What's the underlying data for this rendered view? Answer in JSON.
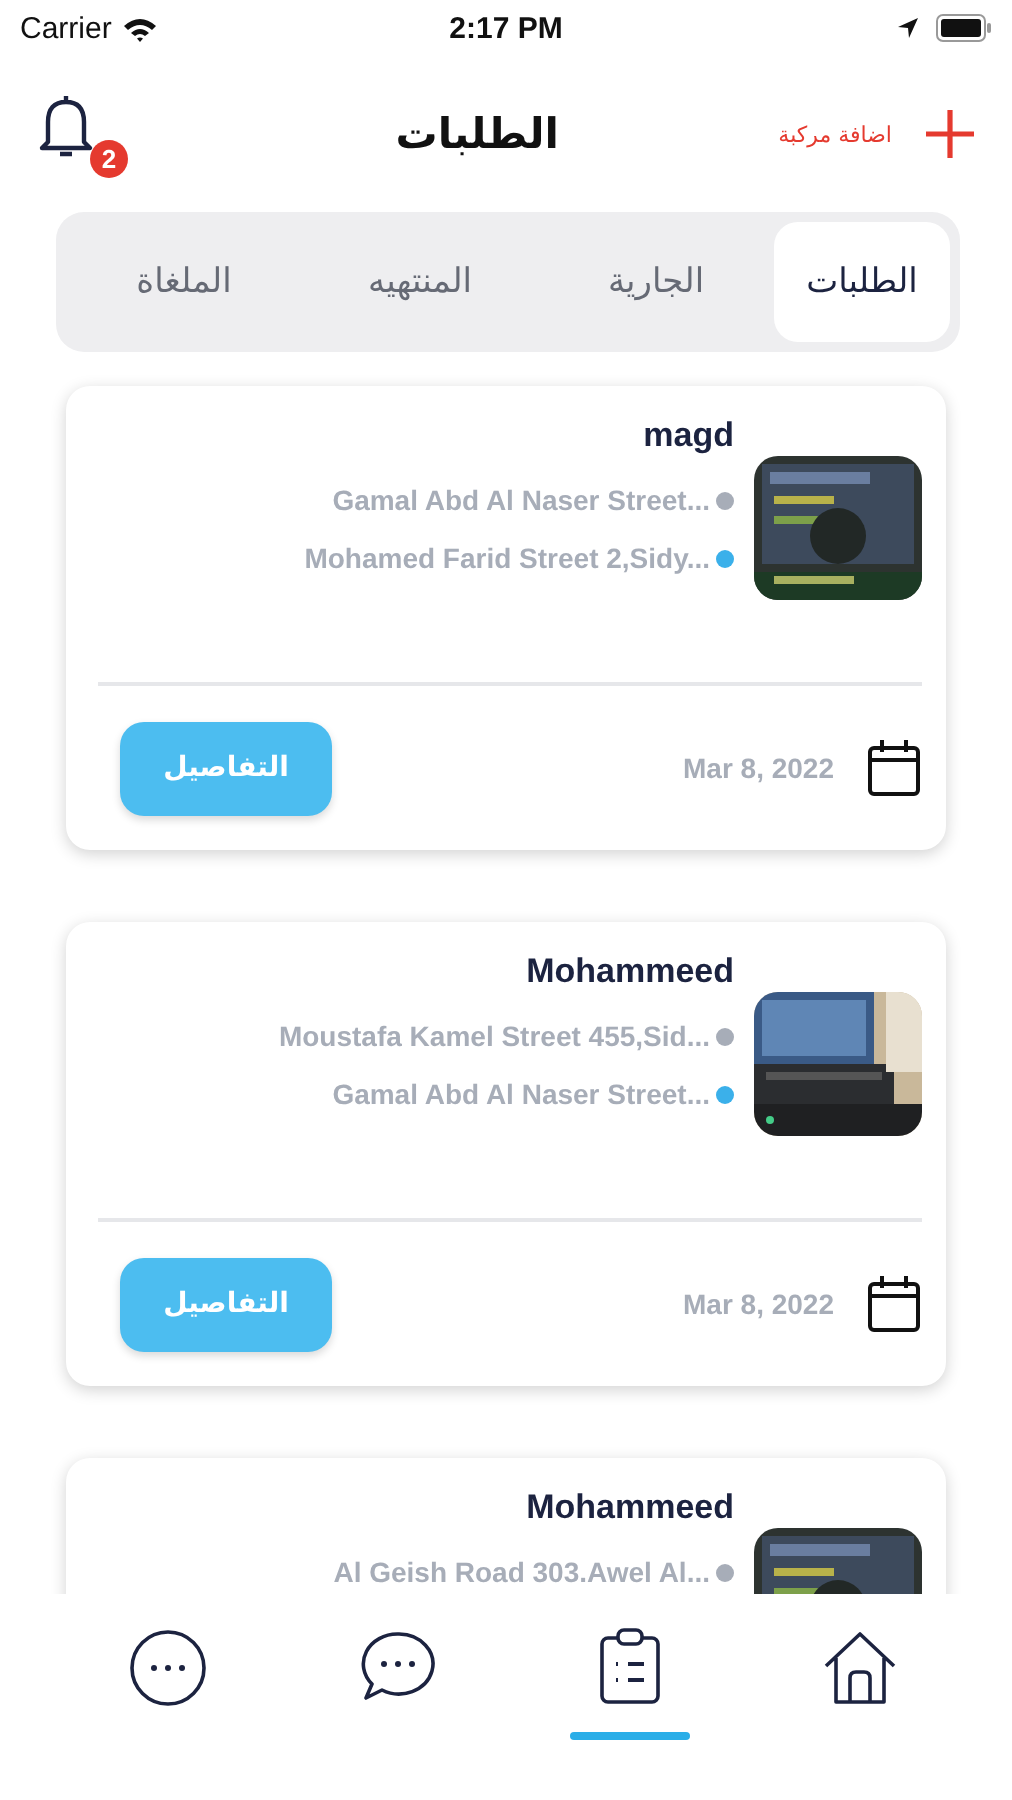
{
  "status_bar": {
    "carrier": "Carrier",
    "time": "2:17 PM"
  },
  "header": {
    "title": "الطلبات",
    "notifications": {
      "count": "2"
    },
    "add_button": {
      "label": "اضافة مركبة"
    }
  },
  "tabs": [
    {
      "label": "الطلبات",
      "selected": true
    },
    {
      "label": "الجارية",
      "selected": false
    },
    {
      "label": "المنتهيه",
      "selected": false
    },
    {
      "label": "الملغاة",
      "selected": false
    }
  ],
  "orders": [
    {
      "name": "magd",
      "picture": {
        "kind": "picture"
      },
      "addresses": [
        {
          "text": "Gamal Abd Al Naser Street...",
          "color": "#a7adb8"
        },
        {
          "text": "Mohamed Farid Street 2,Sidy...",
          "color": "#3bb0ea"
        }
      ],
      "date": "Mar 8, 2022",
      "button": "التفاصيل"
    },
    {
      "name": "Mohammeed",
      "picture": {
        "kind": "picture"
      },
      "addresses": [
        {
          "text": "Moustafa Kamel Street 455,Sid...",
          "color": "#a7adb8"
        },
        {
          "text": "Gamal Abd Al Naser Street...",
          "color": "#3bb0ea"
        }
      ],
      "date": "Mar 8, 2022",
      "button": "التفاصيل"
    },
    {
      "name": "Mohammeed",
      "picture": {
        "kind": "picture"
      },
      "addresses": [
        {
          "text": "Al Geish Road 303.Awel Al...",
          "color": "#a7adb8"
        }
      ]
    }
  ],
  "bottom_nav": [
    {
      "kind": "more",
      "selected": false
    },
    {
      "kind": "chat",
      "selected": false
    },
    {
      "kind": "orders",
      "selected": true
    },
    {
      "kind": "home",
      "selected": false
    }
  ]
}
